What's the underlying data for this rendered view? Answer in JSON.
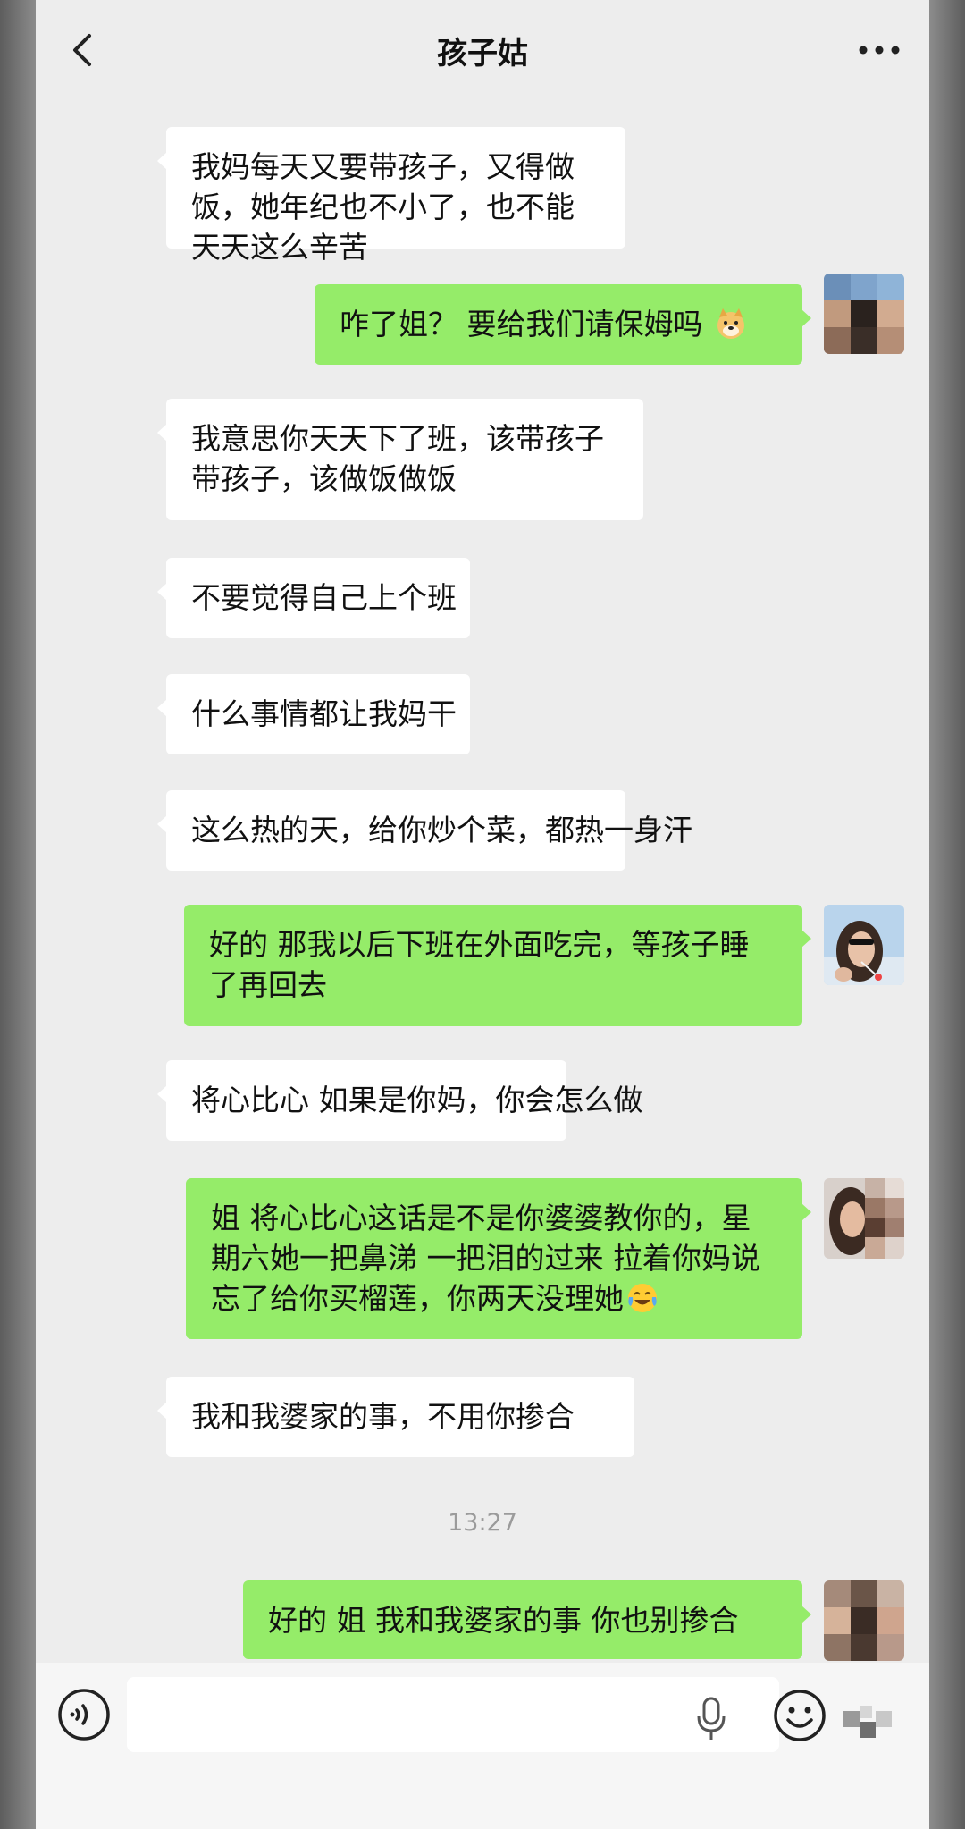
{
  "header": {
    "title": "孩子姑"
  },
  "messages": [
    {
      "side": "in",
      "text": "我妈每天又要带孩子，又得做饭，她年纪也不小了，也不能天天这么辛苦"
    },
    {
      "side": "out",
      "text": "咋了姐？ 要给我们请保姆吗",
      "emoji": "doge-emoji"
    },
    {
      "side": "in",
      "text": "我意思你天天下了班，该带孩子带孩子，该做饭做饭"
    },
    {
      "side": "in",
      "text": "不要觉得自己上个班"
    },
    {
      "side": "in",
      "text": "什么事情都让我妈干"
    },
    {
      "side": "in",
      "text": "这么热的天，给你炒个菜，都热一身汗"
    },
    {
      "side": "out",
      "text": "好的  那我以后下班在外面吃完，等孩子睡了再回去"
    },
    {
      "side": "in",
      "text": "将心比心 如果是你妈，你会怎么做"
    },
    {
      "side": "out",
      "text": "姐 将心比心这话是不是你婆婆教你的，星期六她一把鼻涕 一把泪的过来 拉着你妈说忘了给你买榴莲，你两天没理她",
      "emoji": "crying-laughing-emoji"
    },
    {
      "side": "in",
      "text": "我和我婆家的事，不用你掺合"
    },
    {
      "side": "out",
      "text": "好的 姐 我和我婆家的事 你也别掺合"
    }
  ],
  "timestamp": "13:27",
  "input": {
    "value": "",
    "placeholder": ""
  },
  "colors": {
    "background": "#ededed",
    "incoming_bubble": "#ffffff",
    "outgoing_bubble": "#95ec69",
    "text": "#111111",
    "timestamp": "#9b9b9b"
  },
  "icons": [
    "back-arrow-icon",
    "more-dots-icon",
    "voice-icon",
    "mic-icon",
    "emoji-icon",
    "plus-icon"
  ]
}
